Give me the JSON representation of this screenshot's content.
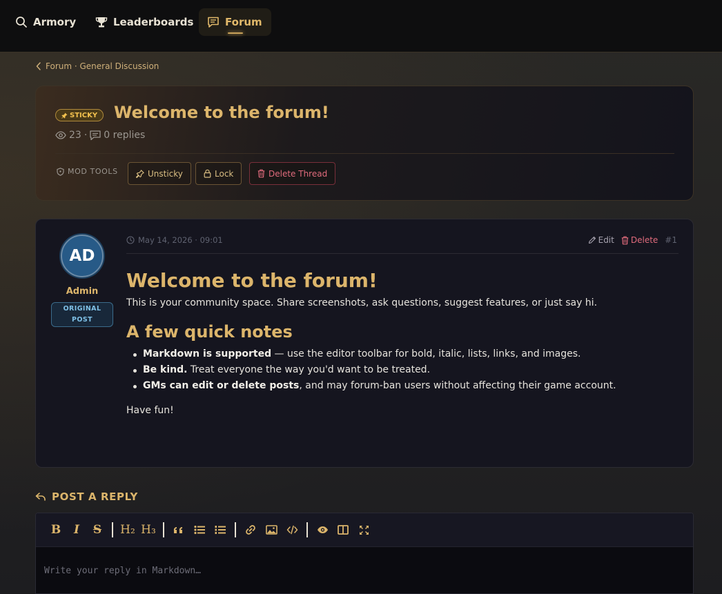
{
  "nav": {
    "items": [
      {
        "label": "Armory",
        "icon": "search-icon"
      },
      {
        "label": "Leaderboards",
        "icon": "trophy-icon"
      },
      {
        "label": "Forum",
        "icon": "chat-icon",
        "active": true
      }
    ]
  },
  "breadcrumb": {
    "text": "Forum · General Discussion"
  },
  "thread": {
    "badge": "STICKY",
    "title": "Welcome to the forum!",
    "views": "23",
    "separator": "·",
    "replies": "0 replies",
    "mod_tools_label": "MOD TOOLS",
    "buttons": {
      "unsticky": "Unsticky",
      "lock": "Lock",
      "delete": "Delete Thread"
    }
  },
  "post": {
    "avatar_initials": "AD",
    "author": "Admin",
    "badge_line1": "ORIGINAL",
    "badge_line2": "POST",
    "timestamp": "May 14, 2026 · 09:01",
    "actions": {
      "edit": "Edit",
      "delete": "Delete",
      "number": "#1"
    },
    "heading": "Welcome to the forum!",
    "intro": "This is your community space. Share screenshots, ask questions, suggest features, or just say hi.",
    "subheading": "A few quick notes",
    "bullets": [
      {
        "bold": "Markdown is supported",
        "rest": " — use the editor toolbar for bold, italic, lists, links, and images."
      },
      {
        "bold": "Be kind.",
        "rest": " Treat everyone the way you'd want to be treated."
      },
      {
        "bold": "GMs can edit or delete posts",
        "rest": ", and may forum-ban users without affecting their game account."
      }
    ],
    "outro": "Have fun!"
  },
  "reply": {
    "heading": "POST A REPLY",
    "placeholder": "Write your reply in Markdown…",
    "toolbar": {
      "bold": "B",
      "italic": "I",
      "strike": "S",
      "h2": "H₂",
      "h3": "H₃"
    }
  },
  "colors": {
    "accent_gold": "#dcb56b",
    "danger": "#e06b7c",
    "card_bg": "#15151f",
    "topbar_bg": "#0e0e0f"
  }
}
